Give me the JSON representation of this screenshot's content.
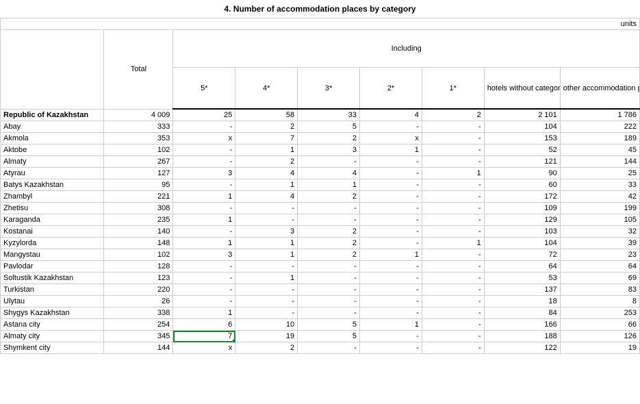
{
  "title": "4. Number of  accommodation places by category",
  "units_label": "units",
  "headers": {
    "total": "Total",
    "including": "Including",
    "s5": "5*",
    "s4": "4*",
    "s3": "3*",
    "s2": "2*",
    "s1": "1*",
    "hotels_wo": "hotels without categories",
    "other": "other accommodation places"
  },
  "rows": [
    {
      "name": "Republic of Kazakhstan",
      "total": "4 009",
      "s5": "25",
      "s4": "58",
      "s3": "33",
      "s2": "4",
      "s1": "2",
      "hw": "2 101",
      "other": "1 786",
      "bold": true
    },
    {
      "name": "Abay",
      "total": "333",
      "s5": "-",
      "s4": "2",
      "s3": "5",
      "s2": "-",
      "s1": "-",
      "hw": "104",
      "other": "222"
    },
    {
      "name": "Akmola",
      "total": "353",
      "s5": "x",
      "s4": "7",
      "s3": "2",
      "s2": "x",
      "s1": "-",
      "hw": "153",
      "other": "189"
    },
    {
      "name": "Aktobe",
      "total": "102",
      "s5": "-",
      "s4": "1",
      "s3": "3",
      "s2": "1",
      "s1": "-",
      "hw": "52",
      "other": "45"
    },
    {
      "name": "Almaty",
      "total": "267",
      "s5": "-",
      "s4": "2",
      "s3": "-",
      "s2": "-",
      "s1": "-",
      "hw": "121",
      "other": "144"
    },
    {
      "name": "Atyrau",
      "total": "127",
      "s5": "3",
      "s4": "4",
      "s3": "4",
      "s2": "-",
      "s1": "1",
      "hw": "90",
      "other": "25"
    },
    {
      "name": "Batys Kazakhstan",
      "total": "95",
      "s5": "-",
      "s4": "1",
      "s3": "1",
      "s2": "-",
      "s1": "-",
      "hw": "60",
      "other": "33"
    },
    {
      "name": "Zhambyl",
      "total": "221",
      "s5": "1",
      "s4": "4",
      "s3": "2",
      "s2": "-",
      "s1": "-",
      "hw": "172",
      "other": "42"
    },
    {
      "name": "Zhetisu",
      "total": "308",
      "s5": "-",
      "s4": "-",
      "s3": "-",
      "s2": "-",
      "s1": "-",
      "hw": "109",
      "other": "199"
    },
    {
      "name": "Karaganda",
      "total": "235",
      "s5": "1",
      "s4": "-",
      "s3": "-",
      "s2": "-",
      "s1": "-",
      "hw": "129",
      "other": "105"
    },
    {
      "name": "Kostanai",
      "total": "140",
      "s5": "-",
      "s4": "3",
      "s3": "2",
      "s2": "-",
      "s1": "-",
      "hw": "103",
      "other": "32"
    },
    {
      "name": "Kyzylorda",
      "total": "148",
      "s5": "1",
      "s4": "1",
      "s3": "2",
      "s2": "-",
      "s1": "1",
      "hw": "104",
      "other": "39"
    },
    {
      "name": "Mangystau",
      "total": "102",
      "s5": "3",
      "s4": "1",
      "s3": "2",
      "s2": "1",
      "s1": "-",
      "hw": "72",
      "other": "23"
    },
    {
      "name": "Pavlodar",
      "total": "128",
      "s5": "-",
      "s4": "-",
      "s3": "-",
      "s2": "-",
      "s1": "-",
      "hw": "64",
      "other": "64"
    },
    {
      "name": "Soltustik Kazakhstan",
      "total": "123",
      "s5": "-",
      "s4": "1",
      "s3": "-",
      "s2": "-",
      "s1": "-",
      "hw": "53",
      "other": "69"
    },
    {
      "name": "Turkistan",
      "total": "220",
      "s5": "-",
      "s4": "-",
      "s3": "-",
      "s2": "-",
      "s1": "-",
      "hw": "137",
      "other": "83"
    },
    {
      "name": "Ulytau",
      "total": "26",
      "s5": "-",
      "s4": "-",
      "s3": "-",
      "s2": "-",
      "s1": "-",
      "hw": "18",
      "other": "8"
    },
    {
      "name": "Shygys Kazakhstan",
      "total": "338",
      "s5": "1",
      "s4": "-",
      "s3": "-",
      "s2": "-",
      "s1": "-",
      "hw": "84",
      "other": "253"
    },
    {
      "name": "Astana city",
      "total": "254",
      "s5": "6",
      "s4": "10",
      "s3": "5",
      "s2": "1",
      "s1": "-",
      "hw": "166",
      "other": "66"
    },
    {
      "name": "Almaty city",
      "total": "345",
      "s5": "7",
      "s4": "19",
      "s3": "5",
      "s2": "-",
      "s1": "-",
      "hw": "188",
      "other": "126",
      "selected_col": "s5"
    },
    {
      "name": "Shymkent city",
      "total": "144",
      "s5": "x",
      "s4": "2",
      "s3": "-",
      "s2": "-",
      "s1": "-",
      "hw": "122",
      "other": "19"
    }
  ]
}
